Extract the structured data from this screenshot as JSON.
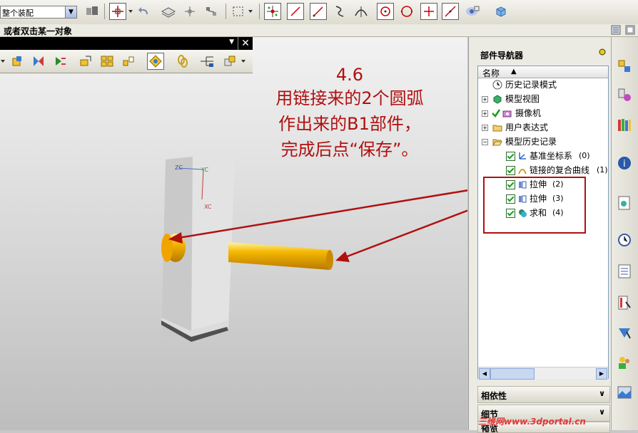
{
  "toolbar": {
    "filter_combo_value": "整个装配",
    "icons": [
      "assembly-icon",
      "snap-point-icon",
      "undo-icon",
      "layer-icon",
      "point-icon",
      "measure-icon",
      "select-box-icon",
      "move-icon",
      "line-icon",
      "diagonal-line-icon",
      "curve-icon",
      "tangent-arc-icon",
      "circle-point-icon",
      "circle-icon",
      "cross-line-icon",
      "angled-line-icon",
      "view-icon",
      "block-icon"
    ]
  },
  "cue_line": "或者双击某一对象",
  "floating_toolbar": {
    "close_label": "✕",
    "icons": [
      "dropdown-icon",
      "add-component-icon",
      "mate-icon",
      "reposition-icon",
      "constraint-icon",
      "component-pattern-icon",
      "mirror-icon",
      "wave-geometry-icon",
      "link-icon",
      "reference-set-icon",
      "explode-icon"
    ]
  },
  "annotation": {
    "title": "4.6",
    "lines": [
      "用链接来的2个圆弧",
      "作出来的B1部件，",
      "完成后点“保存”。"
    ]
  },
  "part_navigator": {
    "title": "部件导航器",
    "column_header": "名称",
    "nodes": [
      {
        "label": "历史记录模式",
        "icon": "clock-icon"
      },
      {
        "label": "模型视图",
        "icon": "model-view-icon"
      },
      {
        "label": "摄像机",
        "icon": "camera-icon"
      },
      {
        "label": "用户表达式",
        "icon": "folder-icon"
      },
      {
        "label": "模型历史记录",
        "icon": "folder-open-icon"
      },
      {
        "label": "基准坐标系",
        "suffix": "(0)"
      },
      {
        "label": "链接的复合曲线",
        "suffix": "(1)"
      },
      {
        "label": "拉伸",
        "suffix": "(2)"
      },
      {
        "label": "拉伸",
        "suffix": "(3)"
      },
      {
        "label": "求和",
        "suffix": "(4)"
      }
    ],
    "sections": [
      "相依性",
      "细节",
      "预览"
    ]
  },
  "viewport_labels": {
    "zc": "ZC",
    "yc": "YC",
    "xc": "XC"
  },
  "watermark": "三维网www.3dportal.cn",
  "colors": {
    "annotation_red": "#b01010",
    "cylinder_orange": "#f5a800",
    "tree_border": "#7f9db9"
  }
}
